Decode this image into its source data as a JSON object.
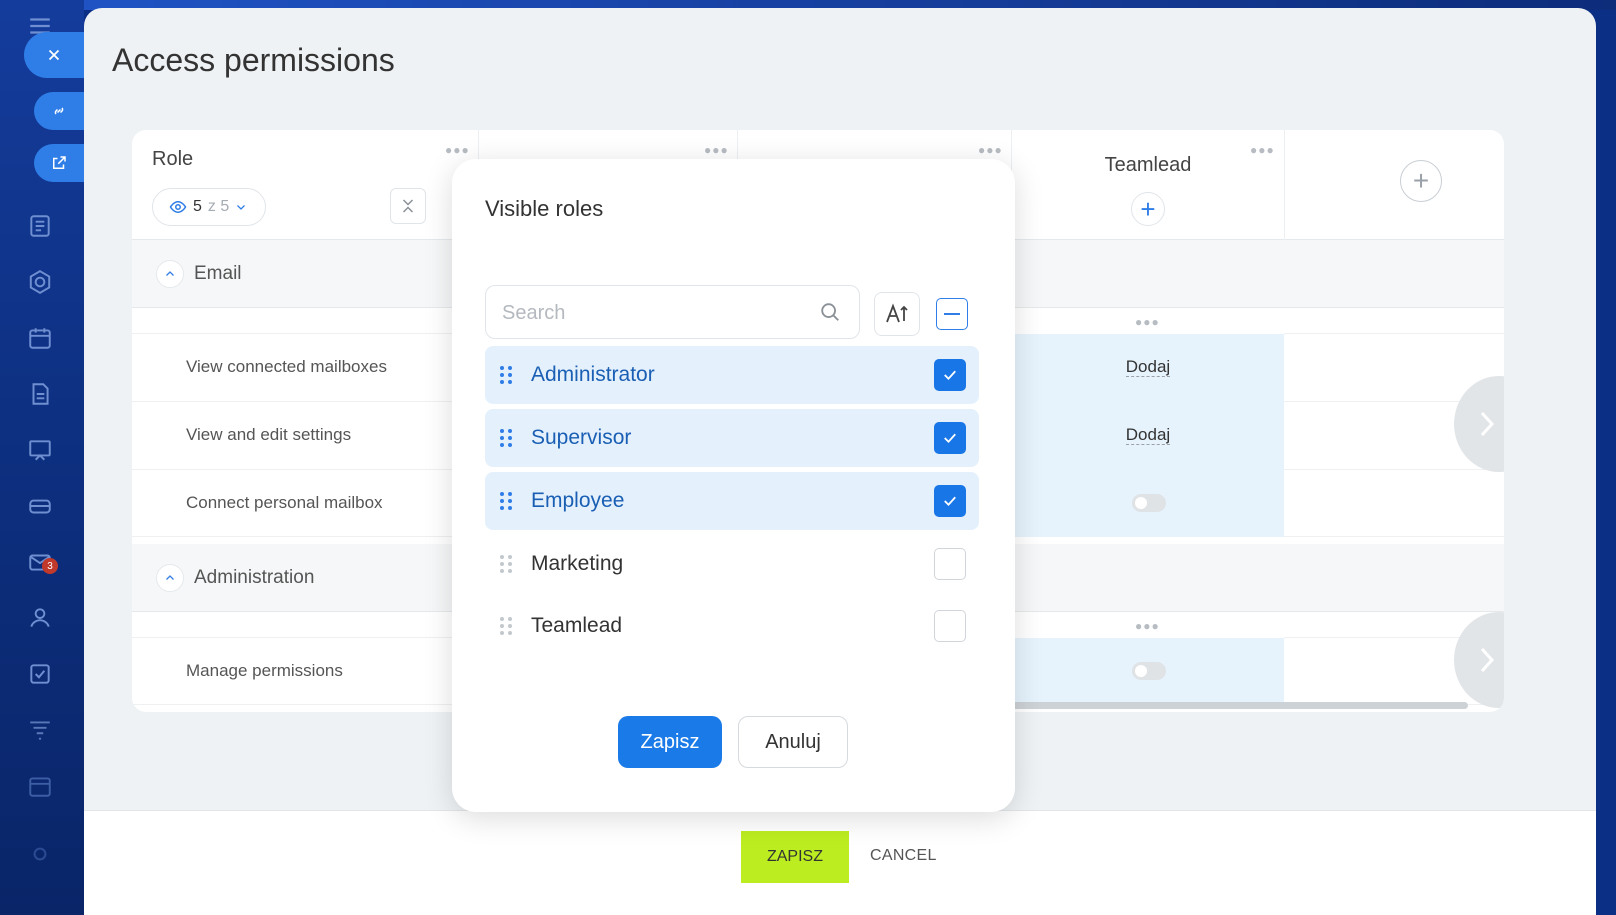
{
  "panel": {
    "title": "Access permissions"
  },
  "table": {
    "role_header": "Role",
    "visible_count": "5",
    "visible_total": "z 5",
    "teamlead_column": "Teamlead",
    "sections": [
      {
        "label": "Email",
        "rows": [
          {
            "label": "View connected mailboxes",
            "teamlead_value": "Dodaj"
          },
          {
            "label": "View and edit settings",
            "teamlead_value": "Dodaj"
          },
          {
            "label": "Connect personal mailbox",
            "teamlead_value": ""
          }
        ]
      },
      {
        "label": "Administration",
        "rows": [
          {
            "label": "Manage permissions",
            "teamlead_value": ""
          }
        ]
      }
    ]
  },
  "rail": {
    "badge_count": "3"
  },
  "modal": {
    "title": "Visible roles",
    "search_placeholder": "Search",
    "items": [
      {
        "label": "Administrator",
        "checked": true
      },
      {
        "label": "Supervisor",
        "checked": true
      },
      {
        "label": "Employee",
        "checked": true
      },
      {
        "label": "Marketing",
        "checked": false
      },
      {
        "label": "Teamlead",
        "checked": false
      }
    ],
    "save_label": "Zapisz",
    "cancel_label": "Anuluj"
  },
  "footer": {
    "save_label": "ZAPISZ",
    "cancel_label": "CANCEL"
  },
  "colors": {
    "accent": "#1a7be8",
    "footer_save": "#bbed21",
    "rail": "#0d2f7f",
    "selected_row": "#e4f1fd"
  }
}
